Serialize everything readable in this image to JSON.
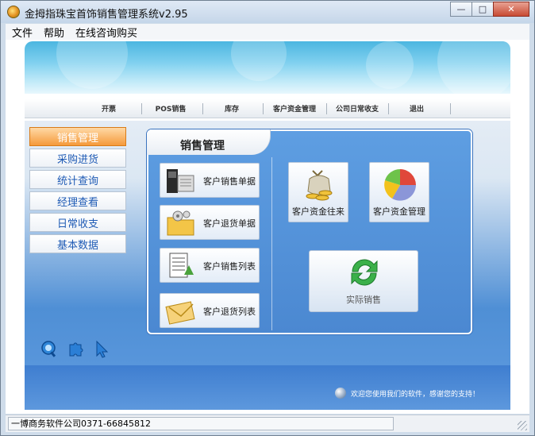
{
  "window": {
    "title": "金拇指珠宝首饰销售管理系统v2.95",
    "buttons": {
      "minimize": "—",
      "maximize": "□",
      "close": "✕"
    }
  },
  "menu": {
    "items": [
      "文件",
      "帮助",
      "在线咨询购买"
    ]
  },
  "nav": {
    "items": [
      "开票",
      "POS销售",
      "库存",
      "客户资金管理",
      "公司日常收支",
      "退出"
    ]
  },
  "sidebar": {
    "items": [
      {
        "label": "销售管理",
        "active": true
      },
      {
        "label": "采购进货",
        "active": false
      },
      {
        "label": "统计查询",
        "active": false
      },
      {
        "label": "经理查看",
        "active": false
      },
      {
        "label": "日常收支",
        "active": false
      },
      {
        "label": "基本数据",
        "active": false
      }
    ]
  },
  "panel": {
    "title": "销售管理",
    "left_items": [
      {
        "label": "客户销售单据",
        "icon": "pos-terminal-icon"
      },
      {
        "label": "客户退货单据",
        "icon": "settings-folder-icon"
      },
      {
        "label": "客户销售列表",
        "icon": "document-list-icon"
      },
      {
        "label": "客户退货列表",
        "icon": "envelope-icon"
      }
    ],
    "right_items": [
      {
        "label": "客户资金往来",
        "icon": "money-bag-icon"
      },
      {
        "label": "客户资金管理",
        "icon": "pie-chart-icon"
      }
    ],
    "real_sales": {
      "label": "实际销售",
      "icon": "refresh-arrows-icon"
    }
  },
  "welcome": {
    "text": "欢迎您使用我们的软件，感谢您的支持！"
  },
  "status": {
    "text": "一博商务软件公司0371-66845812"
  },
  "colors": {
    "accent_orange": "#f59a3b",
    "panel_blue": "#4b88d1",
    "link_blue": "#1f5bb5"
  }
}
